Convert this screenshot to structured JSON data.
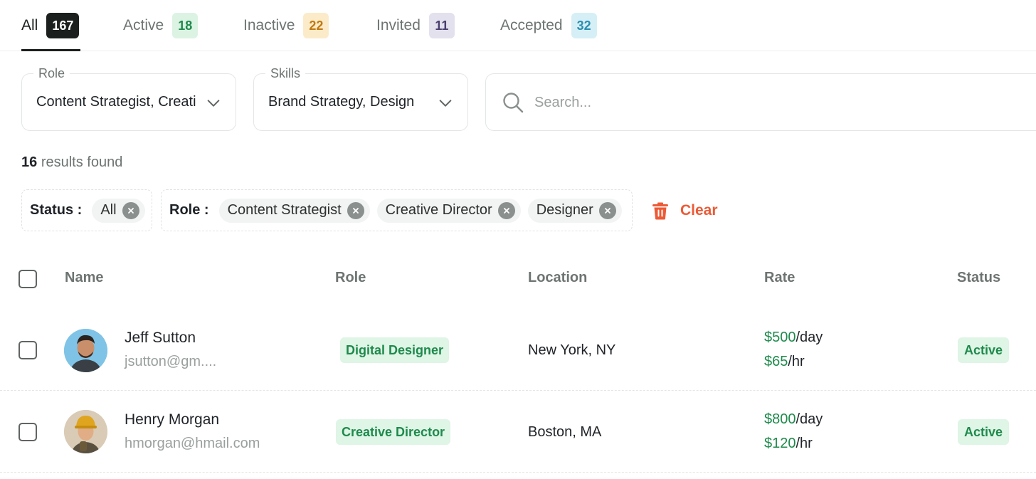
{
  "tabs": [
    {
      "label": "All",
      "count": "167",
      "active": true,
      "badge_bg": "#1b1f1e",
      "badge_color": "#ffffff"
    },
    {
      "label": "Active",
      "count": "18",
      "active": false,
      "badge_bg": "#dcf3e3",
      "badge_color": "#1e8a4c"
    },
    {
      "label": "Inactive",
      "count": "22",
      "active": false,
      "badge_bg": "#fcebc9",
      "badge_color": "#c07a12"
    },
    {
      "label": "Invited",
      "count": "11",
      "active": false,
      "badge_bg": "#e4e1ee",
      "badge_color": "#4a3f6e"
    },
    {
      "label": "Accepted",
      "count": "32",
      "active": false,
      "badge_bg": "#d6eff6",
      "badge_color": "#2a8fb0"
    }
  ],
  "filters": {
    "role": {
      "label": "Role",
      "value": "Content Strategist, Creati",
      "icon": "chevron-down-icon"
    },
    "skills": {
      "label": "Skills",
      "value": "Brand Strategy, Design",
      "icon": "chevron-down-icon"
    },
    "search": {
      "placeholder": "Search...",
      "value": "",
      "icon": "search-icon"
    }
  },
  "results": {
    "count": "16",
    "text": "results found"
  },
  "active_filters": {
    "status": {
      "label": "Status :",
      "chips": [
        "All"
      ]
    },
    "role": {
      "label": "Role :",
      "chips": [
        "Content Strategist",
        "Creative Director",
        "Designer"
      ]
    },
    "clear_label": "Clear",
    "clear_icon": "trash-icon",
    "clear_color": "#ec5a36"
  },
  "table": {
    "columns": [
      "Name",
      "Role",
      "Location",
      "Rate",
      "Status"
    ],
    "rows": [
      {
        "name": "Jeff Sutton",
        "email": "jsutton@gm....",
        "role": "Digital Designer",
        "location": "New York, NY",
        "rate_day": "$500",
        "rate_day_unit": "/day",
        "rate_hr": "$65",
        "rate_hr_unit": "/hr",
        "status": "Active",
        "avatar_bg": "#7fc3e6"
      },
      {
        "name": "Henry Morgan",
        "email": "hmorgan@hmail.com",
        "role": "Creative Director",
        "location": "Boston, MA",
        "rate_day": "$800",
        "rate_day_unit": "/day",
        "rate_hr": "$120",
        "rate_hr_unit": "/hr",
        "status": "Active",
        "avatar_bg": "#d9cbb5"
      }
    ]
  },
  "colors": {
    "accent_green": "#1e8a4c",
    "badge_green_bg": "#dff5e6",
    "text_muted": "#6d7472"
  }
}
